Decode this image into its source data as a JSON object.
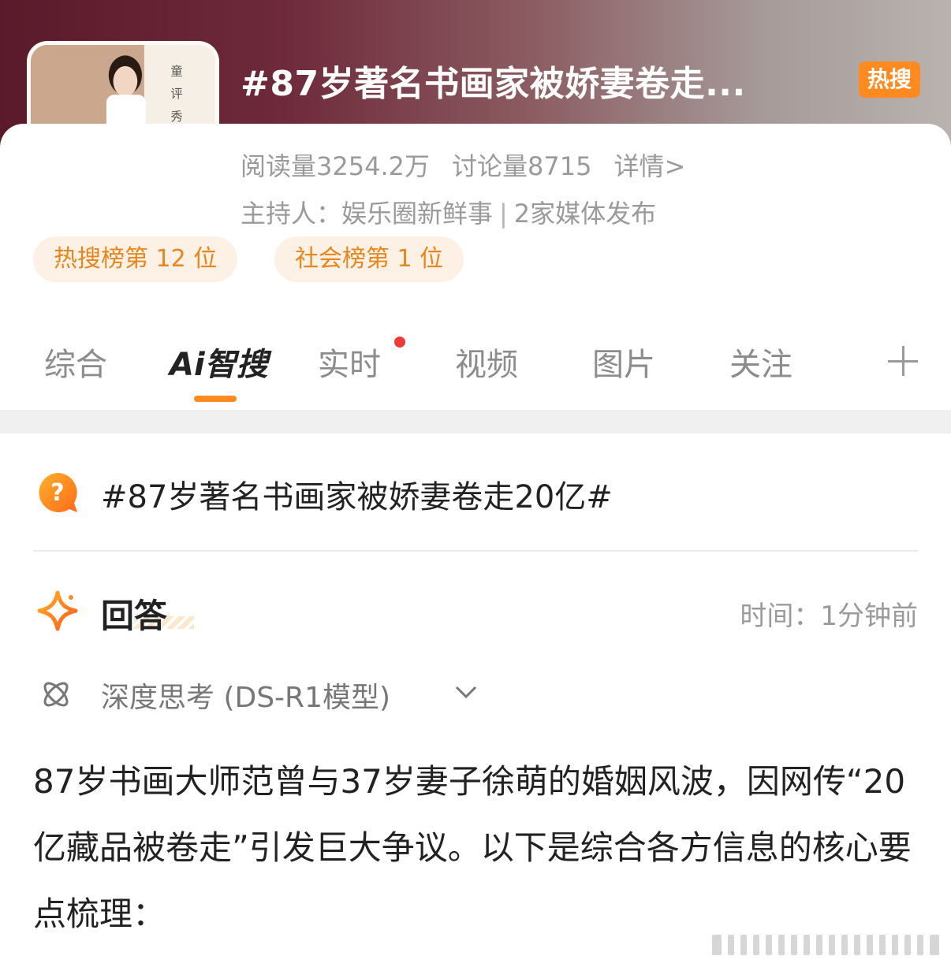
{
  "header": {
    "title": "#87岁著名书画家被娇妻卷走...",
    "badge": "热搜",
    "stats": {
      "reads": "阅读量3254.2万",
      "discussions": "讨论量8715",
      "details": "详情>"
    },
    "host": {
      "label": "主持人：娱乐圈新鲜事",
      "separator": "|",
      "media": "2家媒体发布"
    },
    "ranks": [
      "热搜榜第 12 位",
      "社会榜第 1 位"
    ]
  },
  "tabs": {
    "items": [
      "综合",
      "Ai智搜",
      "实时",
      "视频",
      "图片",
      "关注"
    ],
    "active_index": 1,
    "add_icon": "plus-icon"
  },
  "question": {
    "icon": "question-bubble-icon",
    "text": "#87岁著名书画家被娇妻卷走20亿#"
  },
  "answer": {
    "icon": "sparkle-icon",
    "title": "回答",
    "time": "时间：1分钟前",
    "deep_think": "深度思考 (DS-R1模型)",
    "paragraph": "87岁书画大师范曾与37岁妻子徐萌的婚姻风波，因网传“20亿藏品被卷走”引发巨大争议。以下是综合各方信息的核心要点梳理："
  },
  "colors": {
    "accent": "#ff8a1f",
    "rank_bg": "#fdf0e4",
    "rank_text": "#e8861e",
    "dot": "#f03a3a"
  }
}
